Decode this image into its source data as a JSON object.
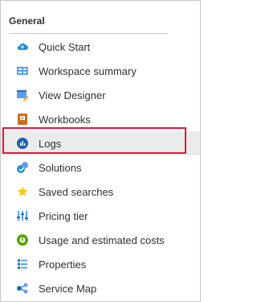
{
  "section": {
    "title": "General"
  },
  "menu": {
    "items": [
      {
        "label": "Quick Start",
        "icon": "cloud-lightning-icon"
      },
      {
        "label": "Workspace summary",
        "icon": "summary-card-icon"
      },
      {
        "label": "View Designer",
        "icon": "view-designer-icon"
      },
      {
        "label": "Workbooks",
        "icon": "workbook-icon"
      },
      {
        "label": "Logs",
        "icon": "logs-icon",
        "selected": true
      },
      {
        "label": "Solutions",
        "icon": "solutions-icon"
      },
      {
        "label": "Saved searches",
        "icon": "star-icon"
      },
      {
        "label": "Pricing tier",
        "icon": "pricing-bars-icon"
      },
      {
        "label": "Usage and estimated costs",
        "icon": "usage-circle-icon"
      },
      {
        "label": "Properties",
        "icon": "properties-icon"
      },
      {
        "label": "Service Map",
        "icon": "service-map-icon"
      }
    ]
  },
  "colors": {
    "highlight": "#e3163f",
    "selected_bg": "#ebebeb",
    "azure_blue": "#0078d4"
  }
}
